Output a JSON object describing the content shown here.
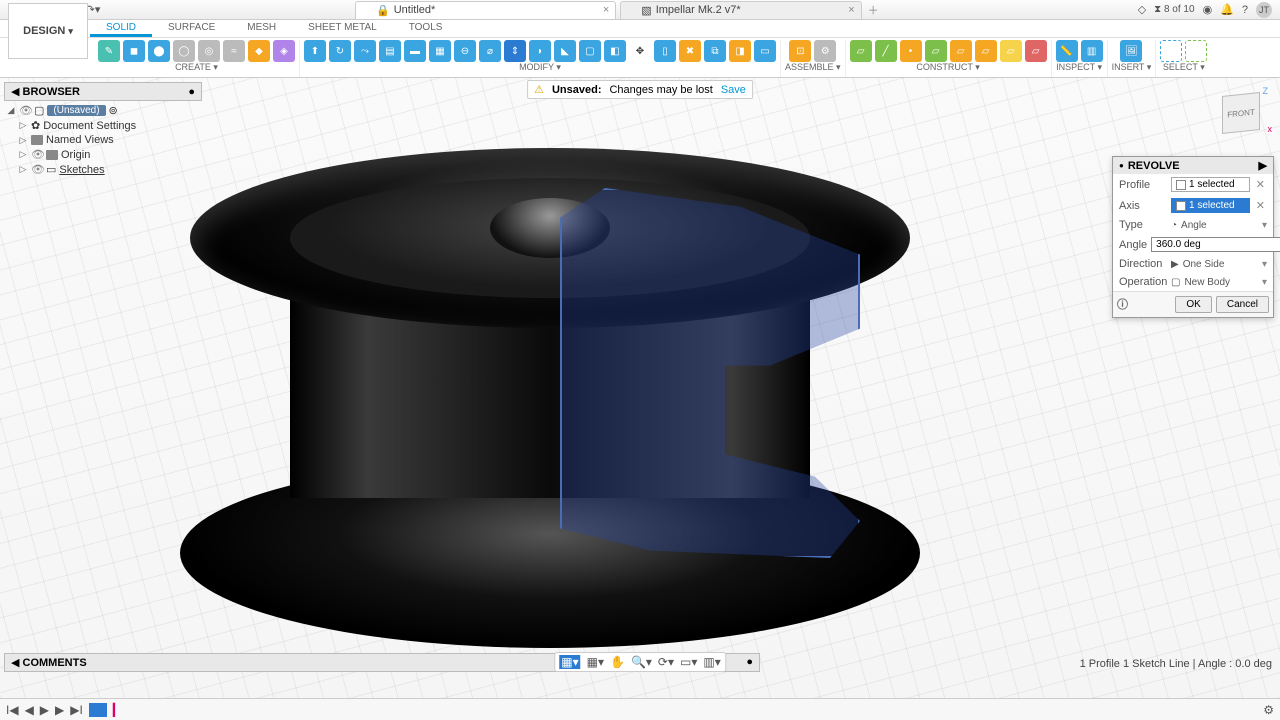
{
  "titlebar": {
    "doc1": "Untitled*",
    "doc2": "Impellar Mk.2 v7*",
    "jobs": "8 of 10",
    "avatar": "JT"
  },
  "ribbon": {
    "tabs": [
      "SOLID",
      "SURFACE",
      "MESH",
      "SHEET METAL",
      "TOOLS"
    ],
    "active": 0
  },
  "design_btn": "DESIGN",
  "groups": {
    "create": "CREATE",
    "modify": "MODIFY",
    "assemble": "ASSEMBLE",
    "construct": "CONSTRUCT",
    "inspect": "INSPECT",
    "insert": "INSERT",
    "select": "SELECT"
  },
  "browser": {
    "title": "BROWSER",
    "root": "(Unsaved)",
    "items": [
      "Document Settings",
      "Named Views",
      "Origin",
      "Sketches"
    ]
  },
  "unsaved": {
    "label": "Unsaved:",
    "msg": "Changes may be lost",
    "save": "Save"
  },
  "viewcube": {
    "front": "FRONT"
  },
  "panel": {
    "title": "REVOLVE",
    "rows": {
      "profile": {
        "label": "Profile",
        "value": "1 selected"
      },
      "axis": {
        "label": "Axis",
        "value": "1 selected"
      },
      "type": {
        "label": "Type",
        "value": "Angle"
      },
      "angle": {
        "label": "Angle",
        "value": "360.0 deg"
      },
      "direction": {
        "label": "Direction",
        "value": "One Side"
      },
      "operation": {
        "label": "Operation",
        "value": "New Body"
      }
    },
    "ok": "OK",
    "cancel": "Cancel"
  },
  "comments": "COMMENTS",
  "status": "1 Profile 1 Sketch Line | Angle : 0.0 deg"
}
